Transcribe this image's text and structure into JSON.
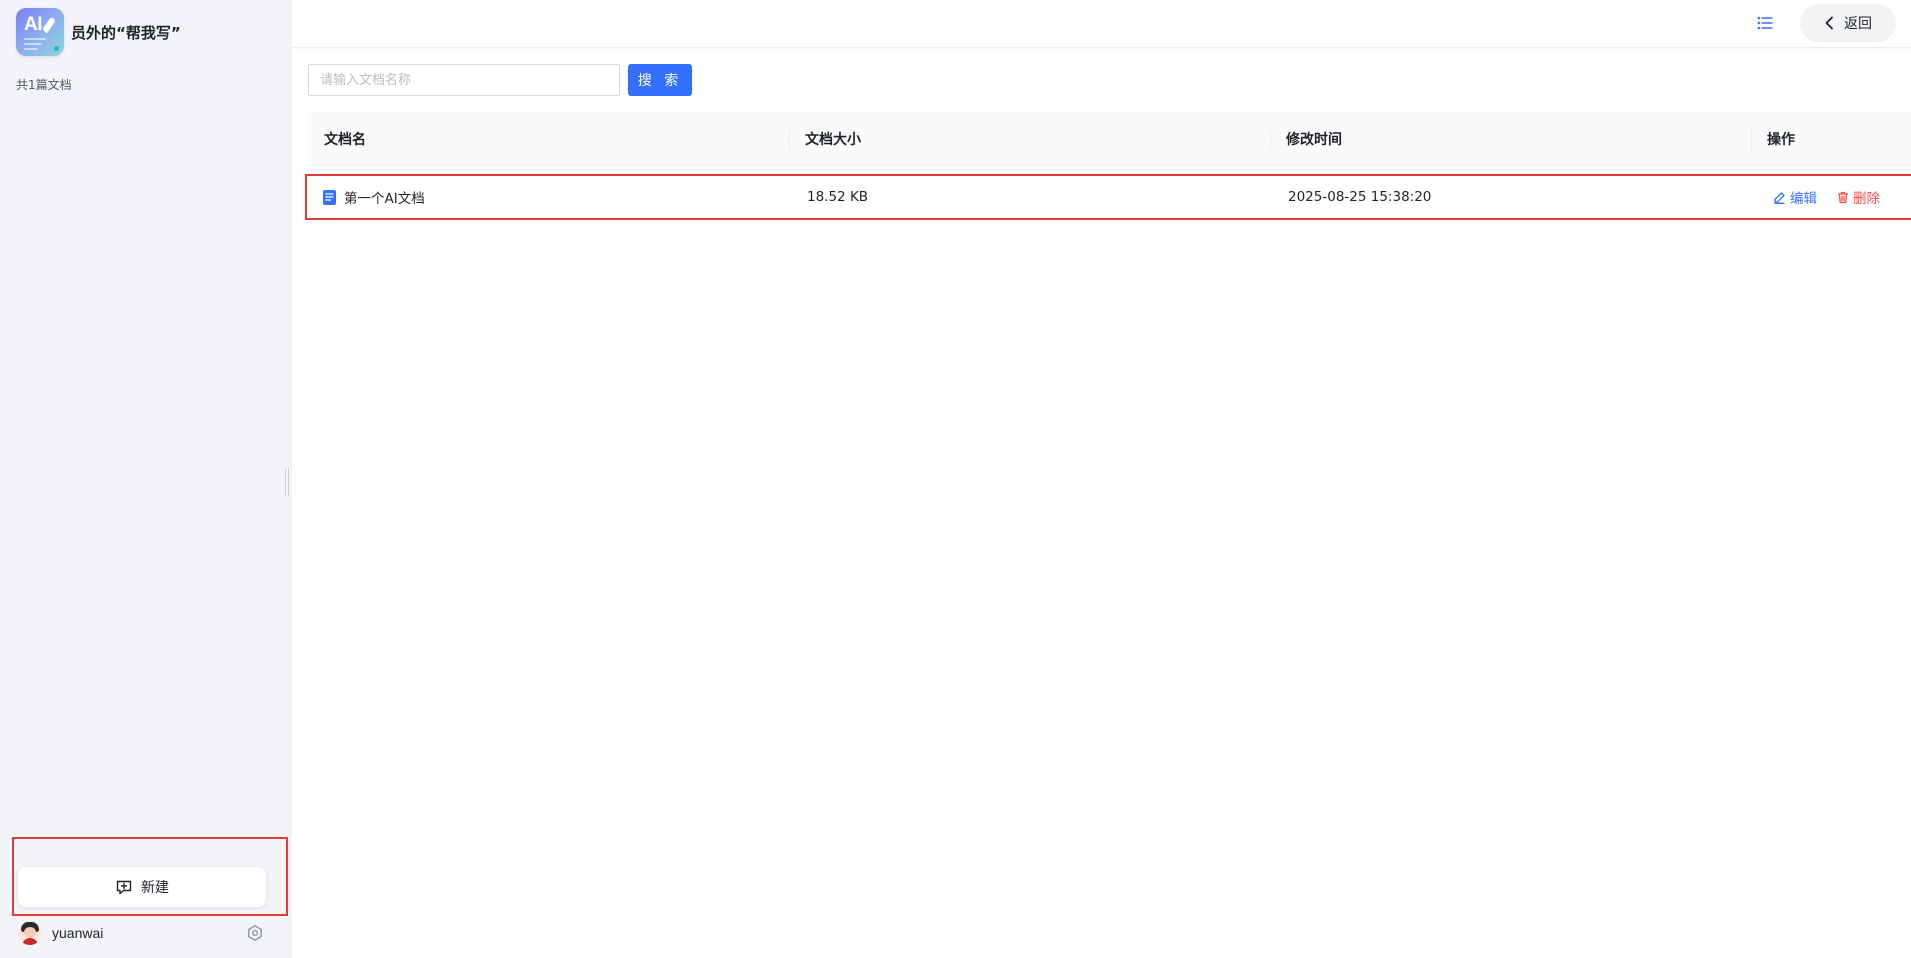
{
  "sidebar": {
    "brand": {
      "logo_text": "AI",
      "title": "员外的“帮我写”"
    },
    "doc_count": "共1篇文档",
    "new_button": {
      "label": "新建",
      "icon": "new-chat-plus-icon"
    },
    "user": {
      "name": "yuanwai",
      "settings_icon": "gear-icon"
    }
  },
  "topbar": {
    "list_icon": "list-icon",
    "back_button": {
      "label": "返回",
      "icon": "chevron-left-icon"
    }
  },
  "search": {
    "placeholder": "请输入文档名称",
    "value": "",
    "button_label": "搜 索"
  },
  "table": {
    "columns": [
      "文档名",
      "文档大小",
      "修改时间",
      "操作"
    ],
    "rows": [
      {
        "name": "第一个AI文档",
        "size": "18.52 KB",
        "modified": "2025-08-25 15:38:20",
        "actions": {
          "edit": "编辑",
          "delete": "删除"
        }
      }
    ]
  },
  "colors": {
    "primary": "#3370ff",
    "danger": "#f54a45",
    "highlight_border": "#e53935",
    "sidebar_bg": "#f3f4f8"
  }
}
